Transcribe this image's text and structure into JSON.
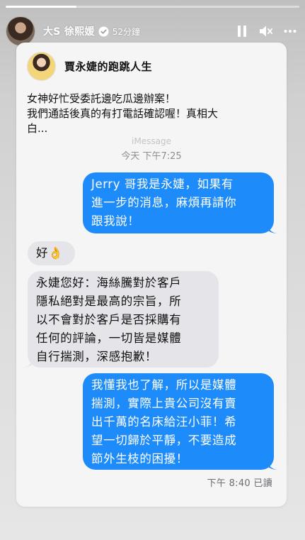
{
  "story": {
    "progress": 0.24,
    "user_name": "大S 徐熙媛",
    "time_ago": "52分鐘"
  },
  "icons": {
    "verified": "verified-badge-icon",
    "pause": "pause-icon",
    "mute": "volume-muted-icon",
    "more": "more-horizontal-icon"
  },
  "colors": {
    "sent_bubble": "#1d8bf9",
    "received_bubble": "#e4e4e9",
    "verified_blue": "#ffffff"
  },
  "card": {
    "author_name": "賈永婕的跑跳人生",
    "caption_lines": [
      "女神好忙受委託邊吃瓜邊辦案！",
      "我們通話後真的有打電話確認喔！真相大",
      "白..."
    ]
  },
  "chat": {
    "header_partial": "iMessage",
    "date": "今天 下午7:25",
    "messages": [
      {
        "from": "me",
        "lines": [
          "Jerry 哥我是永婕，如果有",
          "進一步的消息，麻煩再請你",
          "跟我說！"
        ]
      },
      {
        "from": "them",
        "lines": [
          "好👌"
        ]
      },
      {
        "from": "them",
        "lines": [
          "永婕您好：海絲騰對於客戶",
          "隱私絕對是最高的宗旨，所",
          "以不會對於客戶是否採購有",
          "任何的評論，一切皆是媒體",
          "自行揣測，深感抱歉！"
        ]
      },
      {
        "from": "me",
        "lines": [
          "我懂我也了解，所以是媒體",
          "揣測，實際上貴公司沒有賣",
          "出千萬的名床給汪小菲！希",
          "望一切歸於平靜，不要造成",
          "節外生枝的困擾！"
        ]
      }
    ],
    "read_receipt": "下午 8:40 已讀"
  }
}
